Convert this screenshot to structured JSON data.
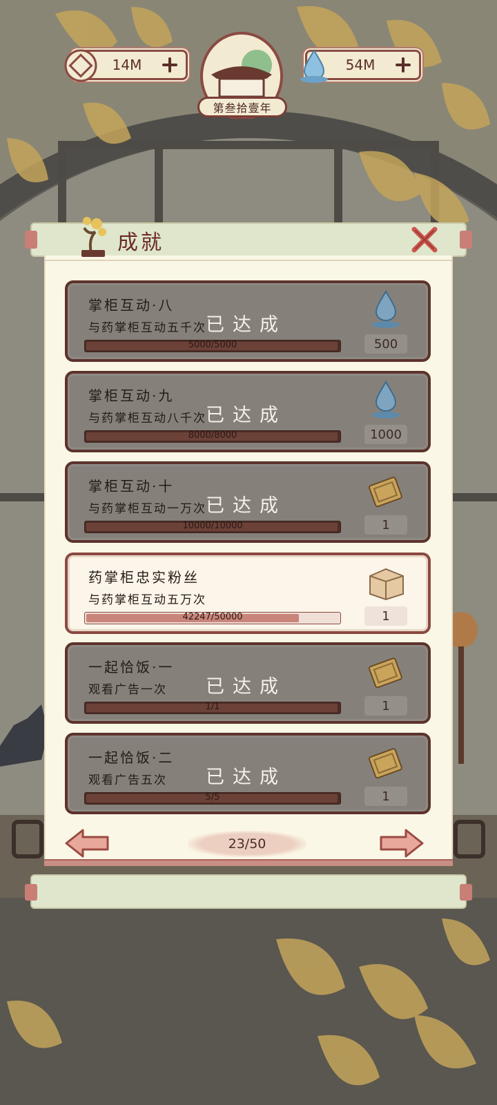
{
  "hud": {
    "coin": {
      "value": "14M",
      "icon": "coin-icon"
    },
    "water": {
      "value": "54M",
      "icon": "water-drop-icon"
    },
    "year": "第叁拾壹年"
  },
  "panel": {
    "title": "成就",
    "close_icon": "close-x-icon"
  },
  "achievements": [
    {
      "name": "掌柜互动·八",
      "desc": "与药掌柜互动五千次",
      "progress": "5000/5000",
      "progress_fraction": 1.0,
      "status": "已达成",
      "completed": true,
      "reward_icon": "water-drop-icon",
      "reward_amount": "500"
    },
    {
      "name": "掌柜互动·九",
      "desc": "与药掌柜互动八千次",
      "progress": "8000/8000",
      "progress_fraction": 1.0,
      "status": "已达成",
      "completed": true,
      "reward_icon": "water-drop-icon",
      "reward_amount": "1000"
    },
    {
      "name": "掌柜互动·十",
      "desc": "与药掌柜互动一万次",
      "progress": "10000/10000",
      "progress_fraction": 1.0,
      "status": "已达成",
      "completed": true,
      "reward_icon": "ticket-icon",
      "reward_amount": "1"
    },
    {
      "name": "药掌柜忠实粉丝",
      "desc": "与药掌柜互动五万次",
      "progress": "42247/50000",
      "progress_fraction": 0.845,
      "status": "",
      "completed": false,
      "reward_icon": "chest-icon",
      "reward_amount": "1"
    },
    {
      "name": "一起恰饭·一",
      "desc": "观看广告一次",
      "progress": "1/1",
      "progress_fraction": 1.0,
      "status": "已达成",
      "completed": true,
      "reward_icon": "ticket-icon",
      "reward_amount": "1"
    },
    {
      "name": "一起恰饭·二",
      "desc": "观看广告五次",
      "progress": "5/5",
      "progress_fraction": 1.0,
      "status": "已达成",
      "completed": true,
      "reward_icon": "ticket-icon",
      "reward_amount": "1"
    }
  ],
  "pagination": {
    "current": "23/50",
    "prev_icon": "arrow-left-icon",
    "next_icon": "arrow-right-icon"
  },
  "colors": {
    "panel_bg": "#fbf7e6",
    "card_done_bg": "#85817a",
    "card_active_bg": "#fbf5ea",
    "border_brown": "#5c332c",
    "accent_red": "#c9564e"
  }
}
